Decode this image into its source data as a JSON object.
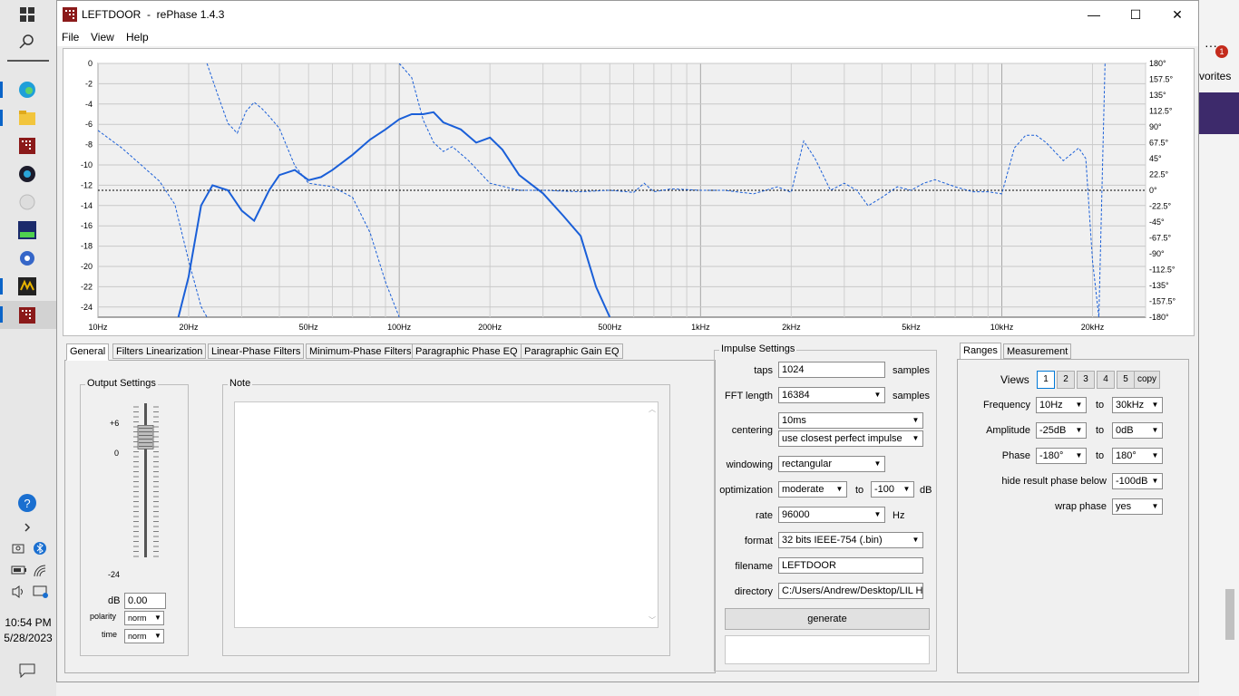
{
  "window": {
    "title": "LEFTDOOR  -  rePhase 1.4.3",
    "controls": {
      "minimize": "—",
      "maximize": "☐",
      "close": "✕"
    }
  },
  "menu": [
    "File",
    "View",
    "Help"
  ],
  "chart": {
    "y_left_ticks": [
      "0",
      "-2",
      "-4",
      "-6",
      "-8",
      "-10",
      "-12",
      "-14",
      "-16",
      "-18",
      "-20",
      "-22",
      "-24"
    ],
    "y_right_ticks": [
      "180°",
      "157.5°",
      "135°",
      "112.5°",
      "90°",
      "67.5°",
      "45°",
      "22.5°",
      "0°",
      "-22.5°",
      "-45°",
      "-67.5°",
      "-90°",
      "-112.5°",
      "-135°",
      "-157.5°",
      "-180°"
    ],
    "x_ticks": [
      "10Hz",
      "20Hz",
      "50Hz",
      "100Hz",
      "200Hz",
      "500Hz",
      "1kHz",
      "2kHz",
      "5kHz",
      "10kHz",
      "20kHz"
    ]
  },
  "chart_data": {
    "type": "line",
    "xscale": "log",
    "xlim": [
      10,
      30000
    ],
    "ylim_left": [
      -25,
      0
    ],
    "ylim_right": [
      -180,
      180
    ],
    "grid": true,
    "series": [
      {
        "axis": "left",
        "style": "solid",
        "x": [
          18.5,
          20,
          22,
          24,
          27,
          30,
          33,
          37,
          40,
          45,
          50,
          55,
          60,
          70,
          80,
          90,
          100,
          110,
          120,
          130,
          140,
          160,
          180,
          200,
          220,
          250,
          300,
          350,
          400,
          450,
          500
        ],
        "y": [
          -25,
          -21,
          -14,
          -12,
          -12.5,
          -14.5,
          -15.5,
          -12.5,
          -11,
          -10.5,
          -11.5,
          -11.2,
          -10.5,
          -9,
          -7.5,
          -6.5,
          -5.5,
          -5,
          -5,
          -4.8,
          -5.8,
          -6.5,
          -7.8,
          -7.3,
          -8.5,
          -11,
          -12.8,
          -15,
          -17,
          -22,
          -25
        ]
      },
      {
        "axis": "right",
        "style": "dashed",
        "x": [
          23,
          25,
          27,
          29,
          31,
          33,
          35,
          37,
          40,
          45,
          50,
          60,
          70,
          80,
          90,
          100
        ],
        "y": [
          180,
          135,
          95,
          81,
          112,
          125,
          116,
          105,
          88,
          35,
          10,
          5,
          -10,
          -60,
          -130,
          -180
        ]
      },
      {
        "axis": "right",
        "style": "dashed",
        "x": [
          10,
          12,
          14,
          16,
          18,
          20,
          22,
          23
        ],
        "y": [
          85,
          60,
          35,
          13,
          -20,
          -100,
          -165,
          -180
        ]
      },
      {
        "axis": "right",
        "style": "dashed",
        "x": [
          100,
          110,
          120,
          130,
          140,
          150,
          170,
          200,
          250,
          300,
          400,
          500,
          600,
          650,
          700,
          800,
          1000,
          1200,
          1500,
          1800,
          2000,
          2200,
          2400,
          2700,
          3000,
          3300,
          3600,
          4000,
          4500,
          5000,
          5500,
          6000,
          7000,
          8000,
          9000,
          10000,
          11000,
          12000,
          13000,
          14000,
          16000,
          18000,
          19000,
          20000,
          21000,
          22000
        ],
        "y": [
          180,
          160,
          100,
          68,
          55,
          62,
          42,
          10,
          0,
          0,
          -2,
          0,
          -3,
          10,
          -2,
          2,
          0,
          0,
          -5,
          5,
          -3,
          70,
          45,
          0,
          10,
          0,
          -22,
          -10,
          5,
          0,
          10,
          15,
          5,
          -2,
          -2,
          -5,
          60,
          78,
          78,
          68,
          42,
          60,
          45,
          -100,
          -180,
          180
        ]
      }
    ],
    "reference_lines": [
      {
        "axis": "right",
        "y": 0,
        "style": "dotted"
      }
    ]
  },
  "tabs": [
    "General",
    "Filters Linearization",
    "Linear-Phase Filters",
    "Minimum-Phase Filters",
    "Paragraphic Phase EQ",
    "Paragraphic Gain EQ"
  ],
  "active_tab": "General",
  "output_settings": {
    "title": "Output Settings",
    "slider_top": "+6",
    "slider_mid": "0",
    "slider_bottom": "-24",
    "db_label": "dB",
    "db_value": "0.00",
    "polarity_label": "polarity",
    "polarity_value": "norm",
    "time_label": "time",
    "time_value": "norm",
    "slider_level_db": 0
  },
  "note": {
    "title": "Note",
    "text": ""
  },
  "impulse": {
    "title": "Impulse Settings",
    "taps_label": "taps",
    "taps_value": "1024",
    "taps_unit": "samples",
    "fft_label": "FFT length",
    "fft_value": "16384",
    "fft_unit": "samples",
    "centering_label": "centering",
    "centering_value": "10ms",
    "centering_mode": "use closest perfect impulse",
    "windowing_label": "windowing",
    "windowing_value": "rectangular",
    "optimization_label": "optimization",
    "optimization_value": "moderate",
    "optimization_to": "to",
    "optimization_db": "-100",
    "optimization_unit": "dB",
    "rate_label": "rate",
    "rate_value": "96000",
    "rate_unit": "Hz",
    "format_label": "format",
    "format_value": "32 bits IEEE-754 (.bin)",
    "filename_label": "filename",
    "filename_value": "LEFTDOOR",
    "directory_label": "directory",
    "directory_value": "C:/Users/Andrew/Desktop/LIL H",
    "generate_label": "generate"
  },
  "ranges": {
    "tabs": [
      "Ranges",
      "Measurement"
    ],
    "views_label": "Views",
    "views": [
      "1",
      "2",
      "3",
      "4",
      "5"
    ],
    "copy_label": "copy",
    "frequency_label": "Frequency",
    "frequency_from": "10Hz",
    "frequency_to": "30kHz",
    "amplitude_label": "Amplitude",
    "amplitude_from": "-25dB",
    "amplitude_to": "0dB",
    "phase_label": "Phase",
    "phase_from": "-180°",
    "phase_to": "180°",
    "to": "to",
    "hide_label": "hide result phase below",
    "hide_value": "-100dB",
    "wrap_label": "wrap phase",
    "wrap_value": "yes"
  },
  "taskbar": {
    "time": "10:54 PM",
    "date": "5/28/2023",
    "notification_count": "1",
    "background_text": "vorites"
  },
  "colors": {
    "curve": "#1a5fd8",
    "accent": "#0078d7",
    "app_icon": "#8b1a1a"
  }
}
